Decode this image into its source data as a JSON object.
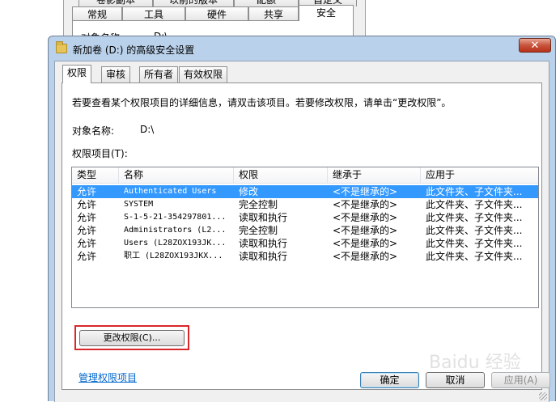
{
  "background_dialog": {
    "top_tabs": [
      "卷影副本",
      "以前的版本",
      "配额",
      "自定义"
    ],
    "tabs": [
      "常规",
      "工具",
      "硬件",
      "共享",
      "安全"
    ],
    "object_label_partial": "对象名称:",
    "object_value_partial": "D:\\"
  },
  "dialog": {
    "title": "新加卷 (D:) 的高级安全设置",
    "close_label": "✕"
  },
  "tabs": [
    "权限",
    "审核",
    "所有者",
    "有效权限"
  ],
  "info_text": "若要查看某个权限项目的详细信息，请双击该项目。若要修改权限，请单击“更改权限”。",
  "object_name": {
    "label": "对象名称:",
    "value": "D:\\"
  },
  "permission_entries_label": "权限项目(T):",
  "permission_list": {
    "columns": [
      "类型",
      "名称",
      "权限",
      "继承于",
      "应用于"
    ],
    "rows": [
      {
        "type": "允许",
        "name": "Authenticated Users",
        "permission": "修改",
        "inherited_from": "<不是继承的>",
        "applies_to": "此文件夹、子文件夹...",
        "selected": true
      },
      {
        "type": "允许",
        "name": "SYSTEM",
        "permission": "完全控制",
        "inherited_from": "<不是继承的>",
        "applies_to": "此文件夹、子文件夹...",
        "selected": false
      },
      {
        "type": "允许",
        "name": "S-1-5-21-354297801...",
        "permission": "读取和执行",
        "inherited_from": "<不是继承的>",
        "applies_to": "此文件夹、子文件夹...",
        "selected": false
      },
      {
        "type": "允许",
        "name": "Administrators (L2...",
        "permission": "完全控制",
        "inherited_from": "<不是继承的>",
        "applies_to": "此文件夹、子文件夹...",
        "selected": false
      },
      {
        "type": "允许",
        "name": "Users (L28ZOX193JK...",
        "permission": "读取和执行",
        "inherited_from": "<不是继承的>",
        "applies_to": "此文件夹、子文件夹...",
        "selected": false
      },
      {
        "type": "允许",
        "name": "职工 (L28ZOX193JKX...",
        "permission": "读取和执行",
        "inherited_from": "<不是继承的>",
        "applies_to": "此文件夹、子文件夹...",
        "selected": false
      }
    ]
  },
  "change_permissions_button": "更改权限(C)...",
  "manage_link": "管理权限项目",
  "buttons": {
    "ok": "确定",
    "cancel": "取消",
    "apply": "应用(A)"
  },
  "watermark": "Baidu 经验",
  "colors": {
    "selection": "#3399ff",
    "highlight_box": "#d9262b",
    "link": "#0066cc"
  }
}
